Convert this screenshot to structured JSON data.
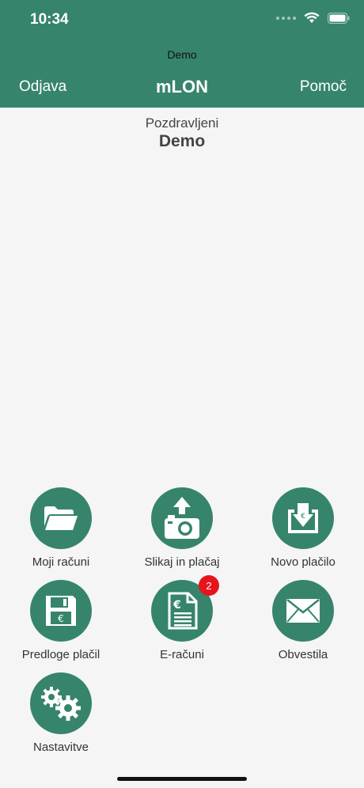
{
  "status_bar": {
    "time": "10:34"
  },
  "header": {
    "subtitle": "Demo",
    "left_button": "Odjava",
    "title": "mLON",
    "right_button": "Pomoč"
  },
  "greeting": {
    "line1": "Pozdravljeni",
    "line2": "Demo"
  },
  "tiles": [
    {
      "label": "Moji računi",
      "icon": "folder-icon"
    },
    {
      "label": "Slikaj in plačaj",
      "icon": "camera-upload-icon"
    },
    {
      "label": "Novo plačilo",
      "icon": "payment-download-icon"
    },
    {
      "label": "Predloge plačil",
      "icon": "floppy-disk-icon"
    },
    {
      "label": "E-računi",
      "icon": "e-invoice-document-icon",
      "badge": "2"
    },
    {
      "label": "Obvestila",
      "icon": "envelope-icon"
    },
    {
      "label": "Nastavitve",
      "icon": "gears-icon"
    }
  ],
  "colors": {
    "primary": "#36846c",
    "badge": "#e8141b",
    "background": "#f5f5f5"
  }
}
